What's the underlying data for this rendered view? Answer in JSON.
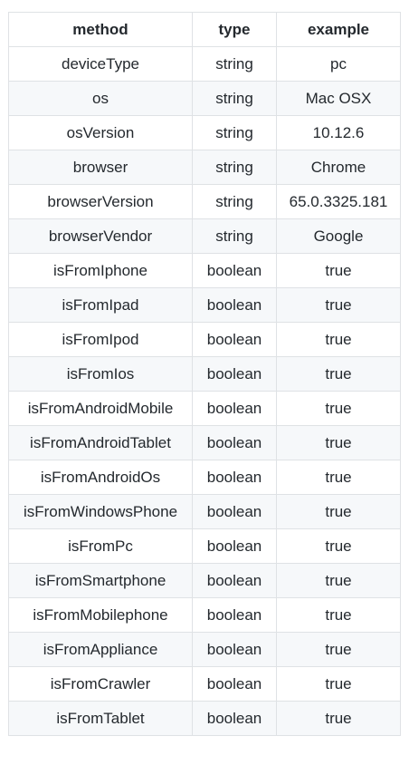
{
  "table": {
    "headers": [
      "method",
      "type",
      "example"
    ],
    "rows": [
      [
        "deviceType",
        "string",
        "pc"
      ],
      [
        "os",
        "string",
        "Mac OSX"
      ],
      [
        "osVersion",
        "string",
        "10.12.6"
      ],
      [
        "browser",
        "string",
        "Chrome"
      ],
      [
        "browserVersion",
        "string",
        "65.0.3325.181"
      ],
      [
        "browserVendor",
        "string",
        "Google"
      ],
      [
        "isFromIphone",
        "boolean",
        "true"
      ],
      [
        "isFromIpad",
        "boolean",
        "true"
      ],
      [
        "isFromIpod",
        "boolean",
        "true"
      ],
      [
        "isFromIos",
        "boolean",
        "true"
      ],
      [
        "isFromAndroidMobile",
        "boolean",
        "true"
      ],
      [
        "isFromAndroidTablet",
        "boolean",
        "true"
      ],
      [
        "isFromAndroidOs",
        "boolean",
        "true"
      ],
      [
        "isFromWindowsPhone",
        "boolean",
        "true"
      ],
      [
        "isFromPc",
        "boolean",
        "true"
      ],
      [
        "isFromSmartphone",
        "boolean",
        "true"
      ],
      [
        "isFromMobilephone",
        "boolean",
        "true"
      ],
      [
        "isFromAppliance",
        "boolean",
        "true"
      ],
      [
        "isFromCrawler",
        "boolean",
        "true"
      ],
      [
        "isFromTablet",
        "boolean",
        "true"
      ]
    ]
  }
}
